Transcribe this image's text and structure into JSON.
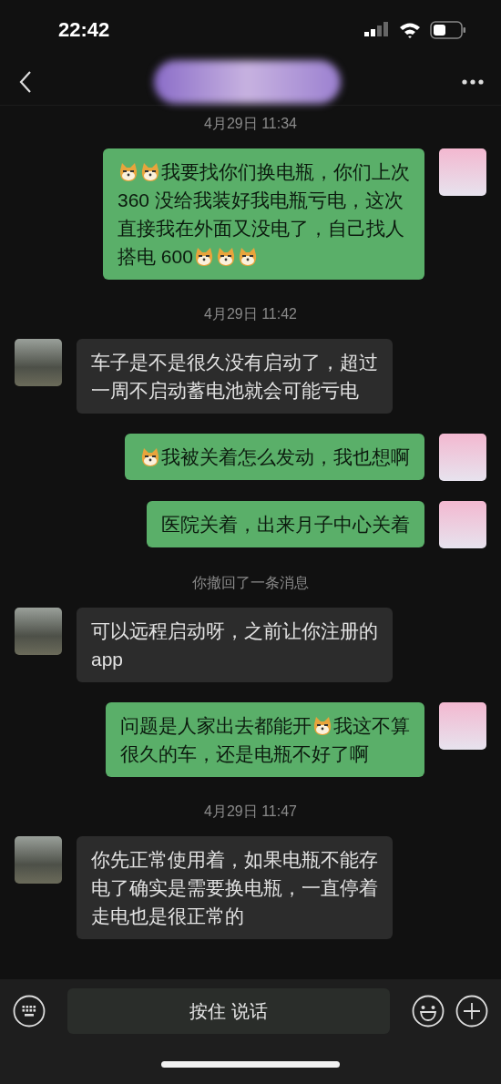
{
  "status_bar": {
    "time": "22:42"
  },
  "chat": {
    "items": [
      {
        "kind": "time",
        "text": "4月29日 11:34"
      },
      {
        "kind": "message",
        "outgoing": true,
        "lines": [
          [
            {
              "kind": "emoji"
            },
            {
              "kind": "emoji"
            },
            {
              "kind": "text",
              "text": "我要找你们换电瓶，你们上次"
            }
          ],
          [
            {
              "kind": "text",
              "text": "360 没给我装好我电瓶亏电，这次"
            }
          ],
          [
            {
              "kind": "text",
              "text": "直接我在外面又没电了，自己找人"
            }
          ],
          [
            {
              "kind": "text",
              "text": "搭电 600"
            },
            {
              "kind": "emoji"
            },
            {
              "kind": "emoji"
            },
            {
              "kind": "emoji"
            }
          ]
        ]
      },
      {
        "kind": "time",
        "text": "4月29日 11:42"
      },
      {
        "kind": "message",
        "outgoing": false,
        "lines": [
          [
            {
              "kind": "text",
              "text": "车子是不是很久没有启动了，超过"
            }
          ],
          [
            {
              "kind": "text",
              "text": "一周不启动蓄电池就会可能亏电"
            }
          ]
        ]
      },
      {
        "kind": "message",
        "outgoing": true,
        "lines": [
          [
            {
              "kind": "emoji"
            },
            {
              "kind": "text",
              "text": "我被关着怎么发动，我也想啊"
            }
          ]
        ]
      },
      {
        "kind": "message",
        "outgoing": true,
        "lines": [
          [
            {
              "kind": "text",
              "text": "医院关着，出来月子中心关着"
            }
          ]
        ]
      },
      {
        "kind": "notice",
        "text": "你撤回了一条消息"
      },
      {
        "kind": "message",
        "outgoing": false,
        "lines": [
          [
            {
              "kind": "text",
              "text": "可以远程启动呀，之前让你注册的"
            }
          ],
          [
            {
              "kind": "text",
              "text": "app"
            }
          ]
        ]
      },
      {
        "kind": "message",
        "outgoing": true,
        "lines": [
          [
            {
              "kind": "text",
              "text": "问题是人家出去都能开"
            },
            {
              "kind": "emoji"
            },
            {
              "kind": "text",
              "text": "我这不算"
            }
          ],
          [
            {
              "kind": "text",
              "text": "很久的车，还是电瓶不好了啊"
            }
          ]
        ]
      },
      {
        "kind": "time",
        "text": "4月29日 11:47"
      },
      {
        "kind": "message",
        "outgoing": false,
        "lines": [
          [
            {
              "kind": "text",
              "text": "你先正常使用着，如果电瓶不能存"
            }
          ],
          [
            {
              "kind": "text",
              "text": "电了确实是需要换电瓶，一直停着"
            }
          ],
          [
            {
              "kind": "text",
              "text": "走电也是很正常的"
            }
          ]
        ]
      }
    ]
  },
  "input_bar": {
    "hold_to_talk": "按住 说话"
  }
}
